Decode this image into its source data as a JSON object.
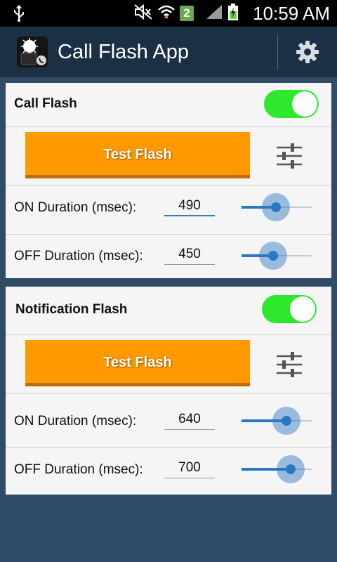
{
  "status_bar": {
    "time": "10:59 AM",
    "sim_badge": "2",
    "icons": [
      "usb-icon",
      "mute-icon",
      "wifi-icon",
      "signal-icon",
      "battery-charging-icon"
    ]
  },
  "app_bar": {
    "title": "Call Flash App",
    "icons": [
      "app-logo-icon",
      "settings-gear-icon"
    ]
  },
  "sections": [
    {
      "title": "Call Flash",
      "enabled": true,
      "test_button": "Test Flash",
      "on_label": "ON Duration (msec):",
      "on_value": "490",
      "off_label": "OFF Duration (msec):",
      "off_value": "450",
      "on_slider_fraction": 0.49,
      "off_slider_fraction": 0.45
    },
    {
      "title": "Notification Flash",
      "enabled": true,
      "test_button": "Test Flash",
      "on_label": "ON Duration (msec):",
      "on_value": "640",
      "off_label": "OFF Duration (msec):",
      "off_value": "700",
      "on_slider_fraction": 0.64,
      "off_slider_fraction": 0.7
    }
  ],
  "colors": {
    "background": "#2f4b66",
    "action_bar": "#1b2f45",
    "accent_orange": "#ff9900",
    "toggle_on": "#2ee82e",
    "slider_blue": "#2a78c4"
  }
}
